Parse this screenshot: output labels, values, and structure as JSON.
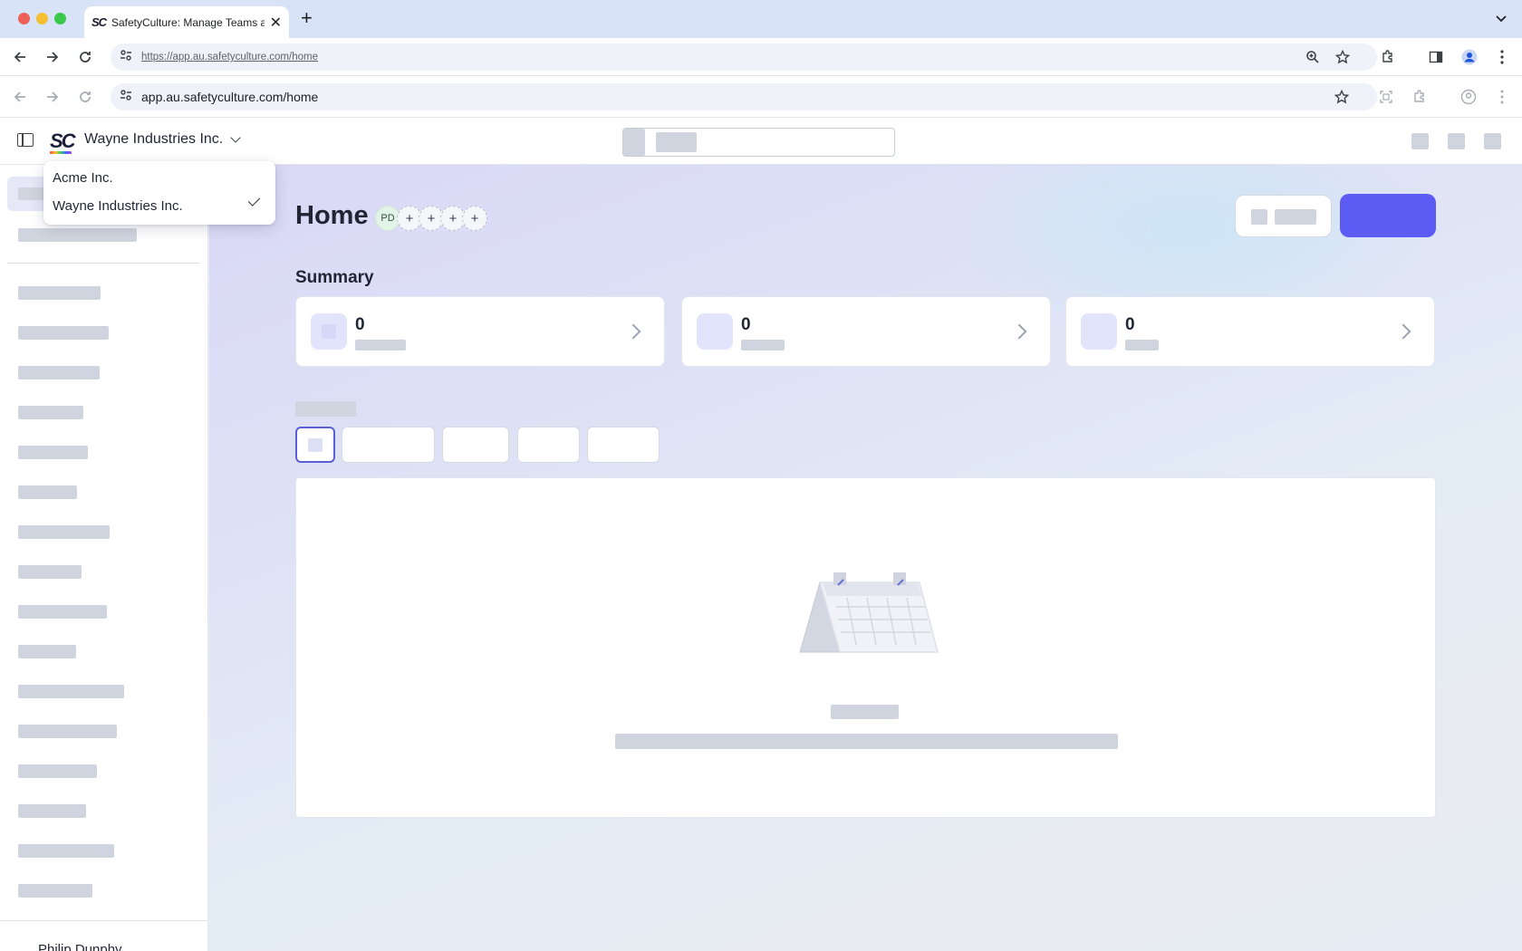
{
  "browser": {
    "tab_title": "SafetyCulture: Manage Teams and...",
    "tab_favicon": "SC",
    "new_tab_label": "+",
    "url_bar1": "https://app.au.safetyculture.com/home",
    "url_bar2": "app.au.safetyculture.com/home"
  },
  "header": {
    "logo": "SC",
    "org_name": "Wayne Industries Inc."
  },
  "org_dropdown": {
    "items": [
      {
        "label": "Acme Inc.",
        "selected": false
      },
      {
        "label": "Wayne Industries Inc.",
        "selected": true
      }
    ]
  },
  "sidebar": {
    "user_name": "Philip Dunphy"
  },
  "main": {
    "title": "Home",
    "avatar_initials": "PD",
    "add_symbol": "+",
    "summary_label": "Summary",
    "cards": [
      {
        "value": "0"
      },
      {
        "value": "0"
      },
      {
        "value": "0"
      }
    ]
  },
  "colors": {
    "primary": "#5c5cf5",
    "active_chip_border": "#5a5fd6",
    "skeleton": "#d0d4de"
  }
}
